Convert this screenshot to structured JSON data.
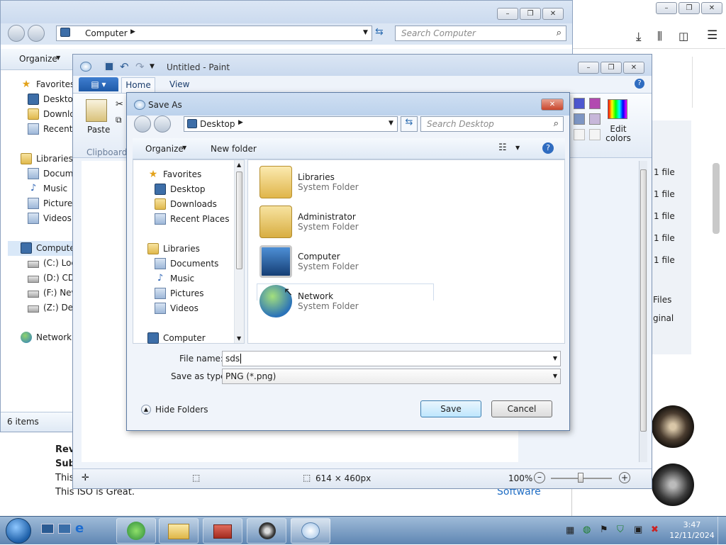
{
  "explorer": {
    "address": "Computer",
    "search_placeholder": "Search Computer",
    "organize_label": "Organize",
    "nav": [
      {
        "label": "Favorites",
        "icon": "star-icon"
      },
      {
        "label": "Desktop",
        "icon": "desktop-icon"
      },
      {
        "label": "Downlo",
        "icon": "downloads-folder-icon"
      },
      {
        "label": "Recent P",
        "icon": "recent-places-icon"
      },
      {
        "label": "Libraries",
        "icon": "libraries-icon"
      },
      {
        "label": "Docume",
        "icon": "documents-icon"
      },
      {
        "label": "Music",
        "icon": "music-icon"
      },
      {
        "label": "Pictures",
        "icon": "pictures-icon"
      },
      {
        "label": "Videos",
        "icon": "videos-icon"
      },
      {
        "label": "Computer",
        "icon": "computer-icon"
      },
      {
        "label": "(C:) Loca",
        "icon": "drive-icon"
      },
      {
        "label": "(D:) CD I",
        "icon": "cd-drive-icon"
      },
      {
        "label": "(F:) New",
        "icon": "drive-icon"
      },
      {
        "label": "(Z:) Dev",
        "icon": "drive-icon"
      },
      {
        "label": "Network",
        "icon": "network-icon"
      }
    ],
    "status": "6 items"
  },
  "browser": {
    "file_rows": [
      "1 file",
      "1 file",
      "1 file",
      "1 file",
      "1 file"
    ],
    "files_text": "Files",
    "original_text": "ginal",
    "software_link": "Software"
  },
  "review": {
    "line1": "Rev",
    "line2": "Sub",
    "line3": "This",
    "line4": "This ISO is Great."
  },
  "paint": {
    "title": "Untitled - Paint",
    "tab_home": "Home",
    "tab_view": "View",
    "paste_label": "Paste",
    "clipboard_label": "Clipboard",
    "edit_colors": "Edit colors",
    "canvas_size": "614 × 460px",
    "zoom": "100%"
  },
  "saveas": {
    "title": "Save As",
    "location": "Desktop",
    "search_placeholder": "Search Desktop",
    "organize_label": "Organize",
    "new_folder_label": "New folder",
    "tree": [
      {
        "label": "Favorites",
        "icon": "star-icon"
      },
      {
        "label": "Desktop",
        "icon": "desktop-icon"
      },
      {
        "label": "Downloads",
        "icon": "downloads-folder-icon"
      },
      {
        "label": "Recent Places",
        "icon": "recent-places-icon"
      },
      {
        "label": "Libraries",
        "icon": "libraries-icon"
      },
      {
        "label": "Documents",
        "icon": "documents-icon"
      },
      {
        "label": "Music",
        "icon": "music-icon"
      },
      {
        "label": "Pictures",
        "icon": "pictures-icon"
      },
      {
        "label": "Videos",
        "icon": "videos-icon"
      },
      {
        "label": "Computer",
        "icon": "computer-icon"
      }
    ],
    "items": [
      {
        "name": "Libraries",
        "type": "System Folder",
        "icon": "libraries-folder-icon"
      },
      {
        "name": "Administrator",
        "type": "System Folder",
        "icon": "user-folder-icon"
      },
      {
        "name": "Computer",
        "type": "System Folder",
        "icon": "computer-icon"
      },
      {
        "name": "Network",
        "type": "System Folder",
        "icon": "network-icon"
      }
    ],
    "file_name_label": "File name:",
    "file_name_value": "sds",
    "save_type_label": "Save as type:",
    "save_type_value": "PNG (*.png)",
    "hide_folders": "Hide Folders",
    "save_button": "Save",
    "cancel_button": "Cancel"
  },
  "taskbar": {
    "time": "3:47",
    "date": "12/11/2024"
  }
}
